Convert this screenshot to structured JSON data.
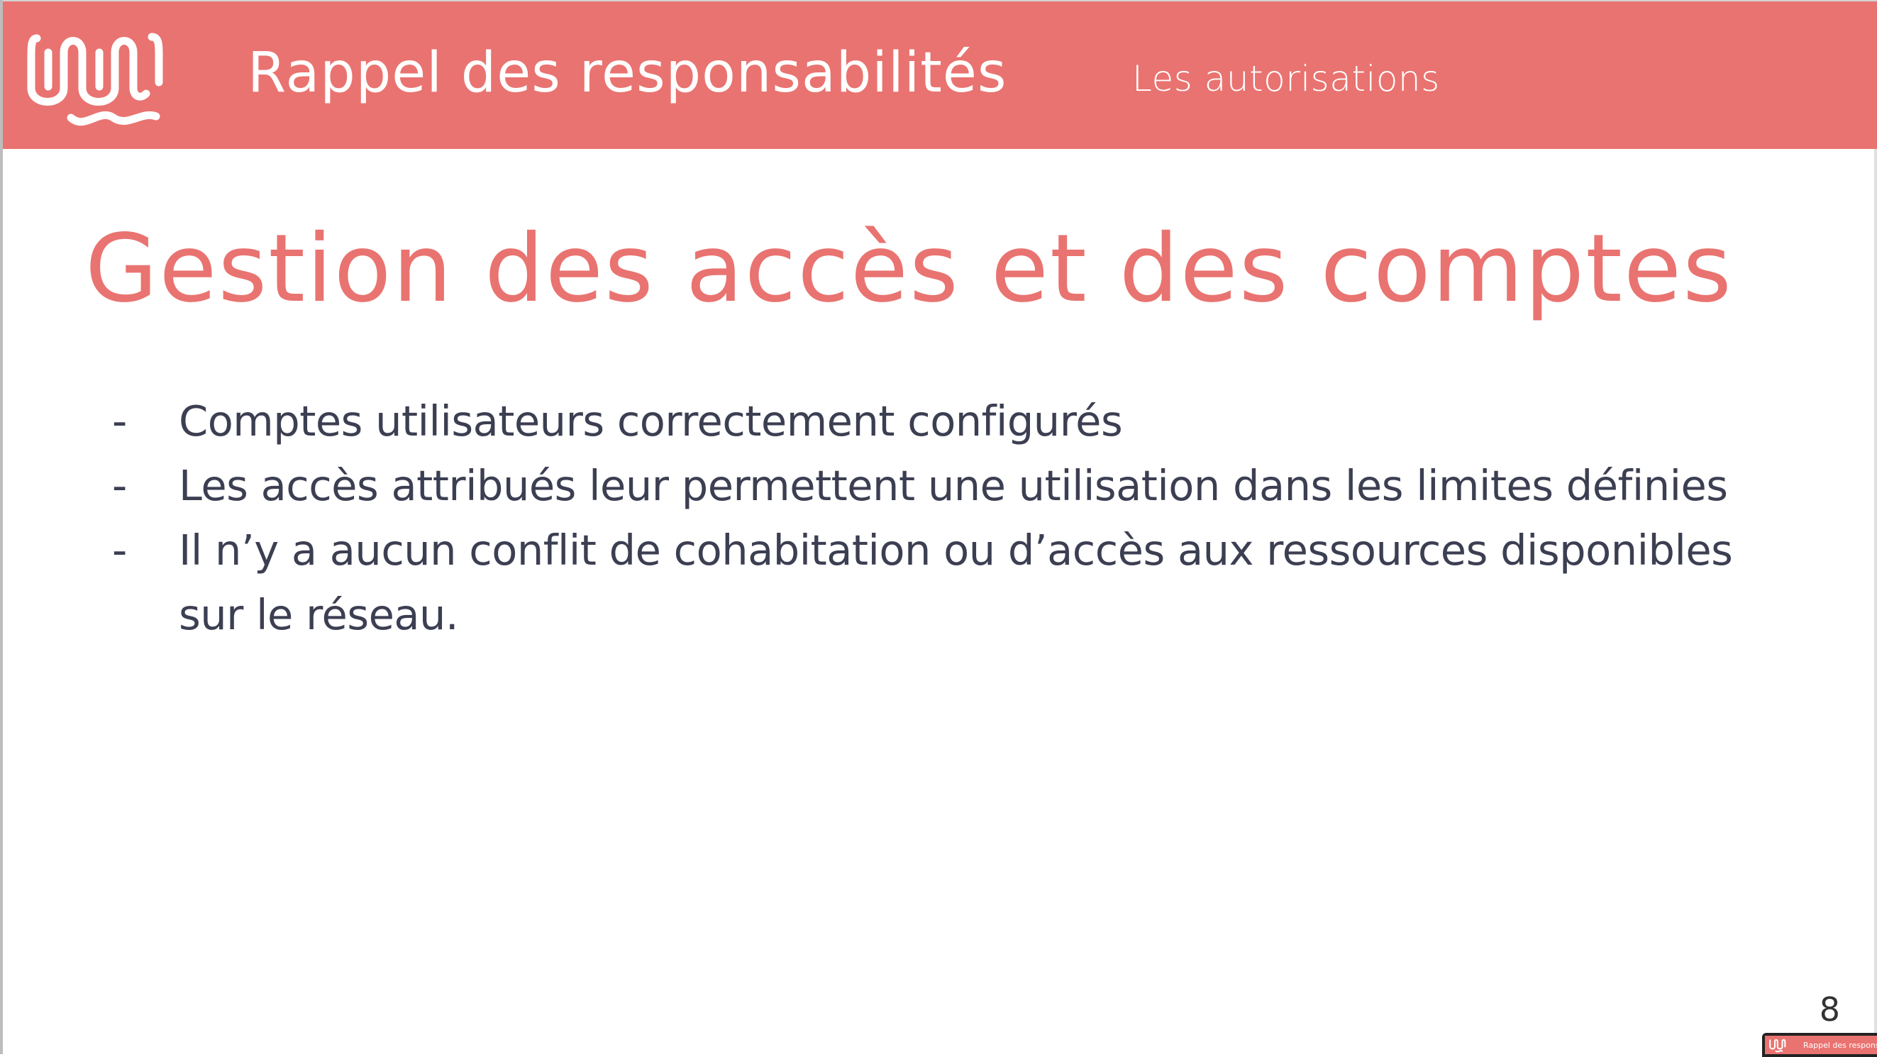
{
  "header": {
    "title": "Rappel des responsabilités",
    "section": "Les autorisations",
    "logo_icon": "wavy-w-logo-icon",
    "color": "#e97370"
  },
  "slide": {
    "title": "Gestion des accès et des comptes",
    "title_color": "#e97370",
    "text_color": "#3c3f52",
    "bullets": [
      {
        "marker": "-",
        "text": "Comptes utilisateurs correctement configurés"
      },
      {
        "marker": "-",
        "text": "Les accès attribués leur permettent une utilisation dans les limites définies"
      },
      {
        "marker": "-",
        "text": "Il n’y a aucun conflit de cohabitation ou d’accès aux ressources disponibles sur le réseau."
      }
    ],
    "page_number": "8"
  },
  "thumbnail": {
    "label": "Rappel des responsabi"
  }
}
